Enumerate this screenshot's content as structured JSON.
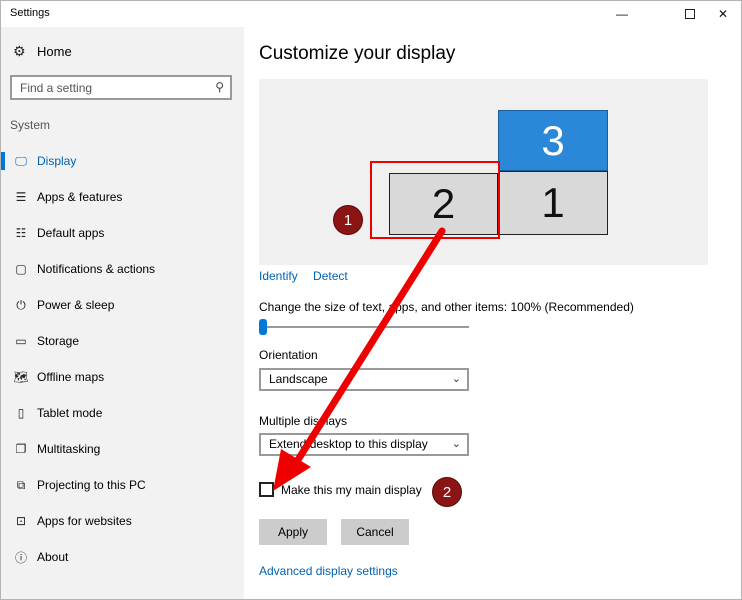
{
  "window": {
    "title": "Settings",
    "min": "—",
    "close": "✕"
  },
  "sidebar": {
    "home": "Home",
    "search_placeholder": "Find a setting",
    "section": "System",
    "items": [
      {
        "label": "Display",
        "icon": "monitor-icon",
        "glyph": "🖵"
      },
      {
        "label": "Apps & features",
        "icon": "list-icon",
        "glyph": "☰"
      },
      {
        "label": "Default apps",
        "icon": "default-apps-icon",
        "glyph": "☷"
      },
      {
        "label": "Notifications & actions",
        "icon": "notification-icon",
        "glyph": "▢"
      },
      {
        "label": "Power & sleep",
        "icon": "power-icon",
        "glyph": "⏻"
      },
      {
        "label": "Storage",
        "icon": "storage-icon",
        "glyph": "▭"
      },
      {
        "label": "Offline maps",
        "icon": "map-icon",
        "glyph": "🗺"
      },
      {
        "label": "Tablet mode",
        "icon": "tablet-icon",
        "glyph": "▯"
      },
      {
        "label": "Multitasking",
        "icon": "multitasking-icon",
        "glyph": "❐"
      },
      {
        "label": "Projecting to this PC",
        "icon": "projecting-icon",
        "glyph": "⧉"
      },
      {
        "label": "Apps for websites",
        "icon": "apps-websites-icon",
        "glyph": "⊡"
      },
      {
        "label": "About",
        "icon": "info-icon",
        "glyph": "ⓘ"
      }
    ]
  },
  "main": {
    "title": "Customize your display",
    "monitors": {
      "m1": "1",
      "m2": "2",
      "m3": "3"
    },
    "badges": {
      "b1": "1",
      "b2": "2"
    },
    "identify": "Identify",
    "detect": "Detect",
    "scale_label": "Change the size of text, apps, and other items: 100% (Recommended)",
    "scale_fraction": 0.0,
    "orientation_label": "Orientation",
    "orientation_value": "Landscape",
    "multiple_label": "Multiple displays",
    "multiple_value": "Extend desktop to this display",
    "main_display_label": "Make this my main display",
    "apply": "Apply",
    "cancel": "Cancel",
    "advanced": "Advanced display settings"
  },
  "colors": {
    "accent": "#0078d7",
    "annotation": "#ee0000",
    "badge": "#8b1414"
  }
}
